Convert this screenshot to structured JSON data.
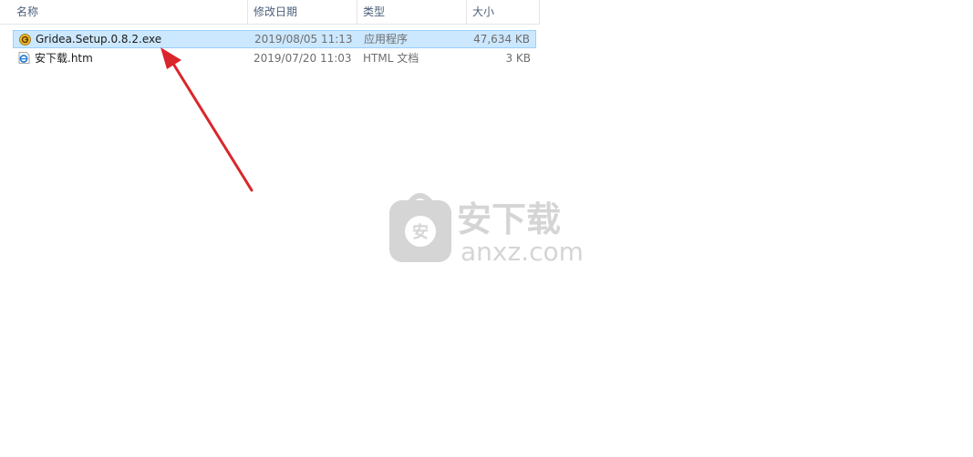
{
  "columns": {
    "name": "名称",
    "date": "修改日期",
    "type": "类型",
    "size": "大小"
  },
  "sort_indicator": "^",
  "files": [
    {
      "name": "Gridea.Setup.0.8.2.exe",
      "date": "2019/08/05 11:13",
      "type": "应用程序",
      "size": "47,634 KB",
      "icon": "gridea-app-icon",
      "selected": true
    },
    {
      "name": "安下载.htm",
      "date": "2019/07/20 11:03",
      "type": "HTML 文档",
      "size": "3 KB",
      "icon": "html-document-icon",
      "selected": false
    }
  ],
  "annotation_arrow_color": "#d9262c",
  "selection_color": "#cce8ff",
  "watermark": {
    "title": "安下载",
    "domain": "anxz.com",
    "color": "#d5d5d5"
  }
}
